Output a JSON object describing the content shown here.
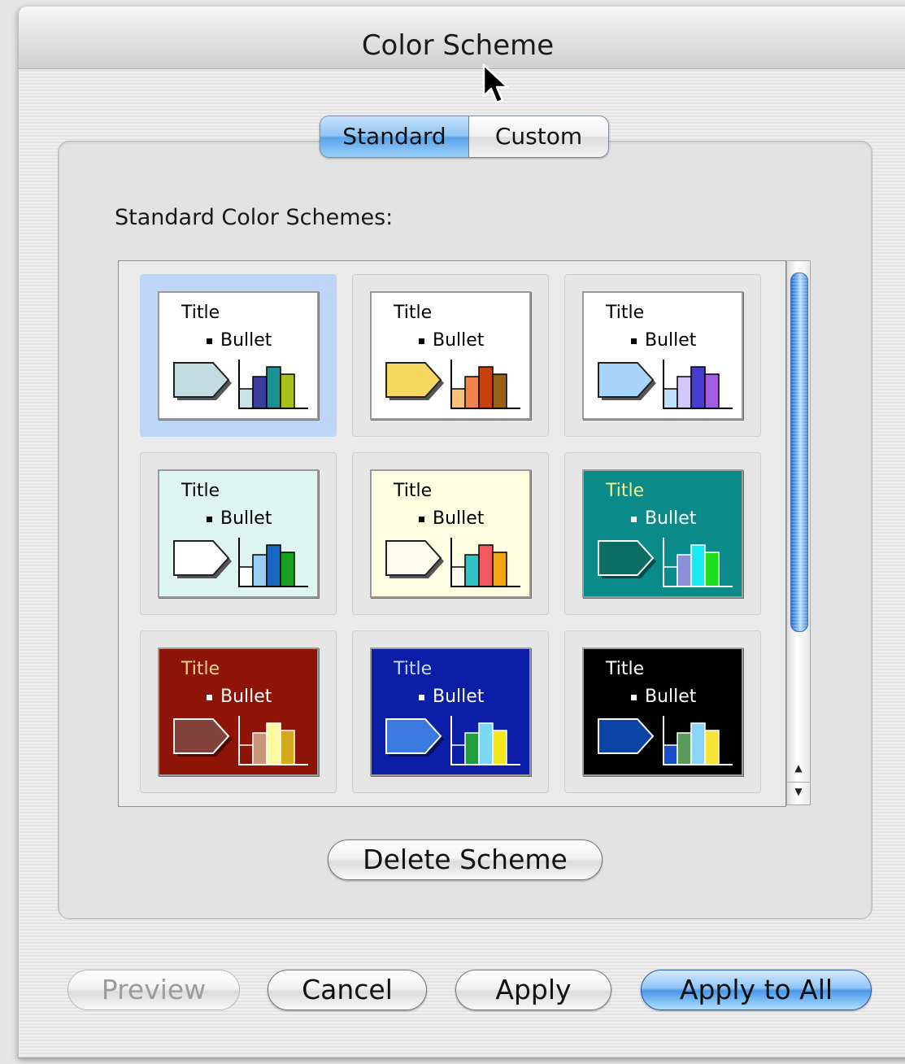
{
  "window": {
    "title": "Color Scheme"
  },
  "segmented": {
    "standard": "Standard",
    "custom": "Custom",
    "selected": "Standard"
  },
  "group": {
    "label": "Standard Color Schemes:"
  },
  "schemes": [
    {
      "title": "Title",
      "bullet": "Bullet",
      "bg": "#ffffff",
      "text": "#000000",
      "title_color": "#000000",
      "shape_fill": "#c2dde0",
      "shape_line": "#222222",
      "bars": [
        "#c8e3e5",
        "#3b3e9a",
        "#19908f",
        "#a9bf1c"
      ],
      "axis": "#000000",
      "selected": true
    },
    {
      "title": "Title",
      "bullet": "Bullet",
      "bg": "#ffffff",
      "text": "#000000",
      "title_color": "#000000",
      "shape_fill": "#f6d860",
      "shape_line": "#222222",
      "bars": [
        "#f9c27a",
        "#f2834b",
        "#c8400c",
        "#9a6210"
      ],
      "axis": "#000000",
      "selected": false
    },
    {
      "title": "Title",
      "bullet": "Bullet",
      "bg": "#ffffff",
      "text": "#000000",
      "title_color": "#000000",
      "shape_fill": "#a9d4fc",
      "shape_line": "#222222",
      "bars": [
        "#bde0fe",
        "#d4c8fb",
        "#4a3ccc",
        "#a15ee0"
      ],
      "axis": "#000000",
      "selected": false
    },
    {
      "title": "Title",
      "bullet": "Bullet",
      "bg": "#dff5f2",
      "text": "#000000",
      "title_color": "#000000",
      "shape_fill": "#ffffff",
      "shape_line": "#222222",
      "bars": [
        "#ffffff",
        "#9acff5",
        "#1668c4",
        "#16a11e"
      ],
      "axis": "#000000",
      "selected": false
    },
    {
      "title": "Title",
      "bullet": "Bullet",
      "bg": "#fffddf",
      "text": "#000000",
      "title_color": "#000000",
      "shape_fill": "#fdfcee",
      "shape_line": "#222222",
      "bars": [
        "#fdfcee",
        "#2ec4c4",
        "#f25a60",
        "#f4a410"
      ],
      "axis": "#000000",
      "selected": false
    },
    {
      "title": "Title",
      "bullet": "Bullet",
      "bg": "#0a8a88",
      "text": "#ffffff",
      "title_color": "#f5ef8a",
      "shape_fill": "#0c6d63",
      "shape_line": "#ffffff",
      "bars": [
        "#0a8a88",
        "#8b8fd8",
        "#16eaf2",
        "#19e019"
      ],
      "axis": "#ffffff",
      "selected": false
    },
    {
      "title": "Title",
      "bullet": "Bullet",
      "bg": "#8e1408",
      "text": "#ffffff",
      "title_color": "#f5d58e",
      "shape_fill": "#82443a",
      "shape_line": "#ffffff",
      "bars": [
        "#8e1408",
        "#c9967a",
        "#fafaa0",
        "#d4aa1a"
      ],
      "axis": "#ffffff",
      "selected": false
    },
    {
      "title": "Title",
      "bullet": "Bullet",
      "bg": "#0c1ea8",
      "text": "#ffffff",
      "title_color": "#c9d8ff",
      "shape_fill": "#3a7ae0",
      "shape_line": "#ffffff",
      "bars": [
        "#0c1ea8",
        "#1e9e3a",
        "#7ad8f5",
        "#f5e619"
      ],
      "axis": "#ffffff",
      "selected": false
    },
    {
      "title": "Title",
      "bullet": "Bullet",
      "bg": "#000000",
      "text": "#ffffff",
      "title_color": "#ffffff",
      "shape_fill": "#0c44a5",
      "shape_line": "#ffffff",
      "bars": [
        "#1a4ec8",
        "#5a9a5a",
        "#8ad4f8",
        "#f7e43a"
      ],
      "axis": "#ffffff",
      "selected": false
    }
  ],
  "bar_levels": [
    0.45,
    0.72,
    0.95,
    0.78
  ],
  "buttons": {
    "delete": "Delete Scheme",
    "preview": "Preview",
    "cancel": "Cancel",
    "apply": "Apply",
    "apply_all": "Apply to All"
  },
  "colors": {
    "accent": "#5aa2e8"
  }
}
